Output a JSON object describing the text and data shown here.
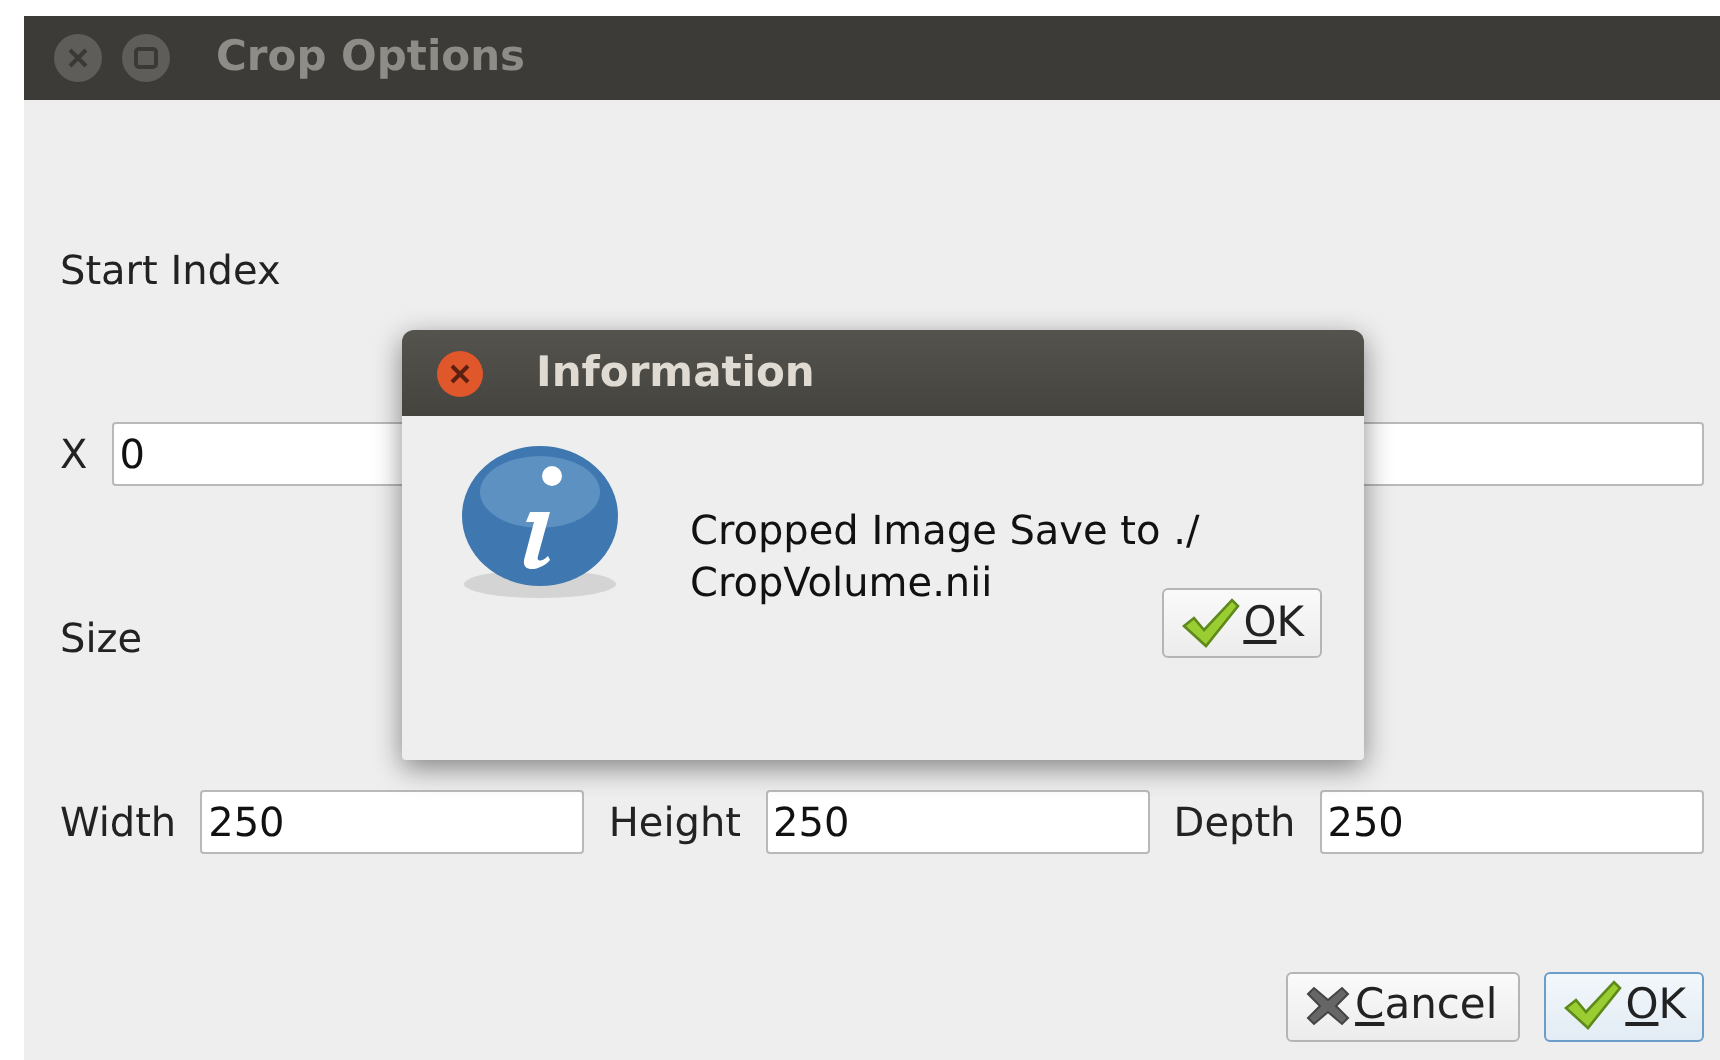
{
  "window": {
    "title": "Crop Options"
  },
  "sections": [
    {
      "label": "Start Index",
      "fields": [
        {
          "label": "X",
          "value": "0"
        }
      ]
    },
    {
      "label": "Size",
      "fields": [
        {
          "label": "Width",
          "value": "250"
        },
        {
          "label": "Height",
          "value": "250"
        },
        {
          "label": "Depth",
          "value": "250"
        }
      ]
    }
  ],
  "buttons": [
    {
      "label": "Cancel",
      "kind": "cancel",
      "default": false,
      "mnemonic_underlined": true
    },
    {
      "label": "OK",
      "kind": "ok",
      "default": true,
      "mnemonic_underlined": true
    }
  ],
  "dialog": {
    "title": "Information",
    "message": "Cropped Image Save to ./ CropVolume.nii",
    "buttons": [
      {
        "label": "OK",
        "kind": "ok",
        "default": false,
        "mnemonic_underlined": true
      }
    ]
  }
}
